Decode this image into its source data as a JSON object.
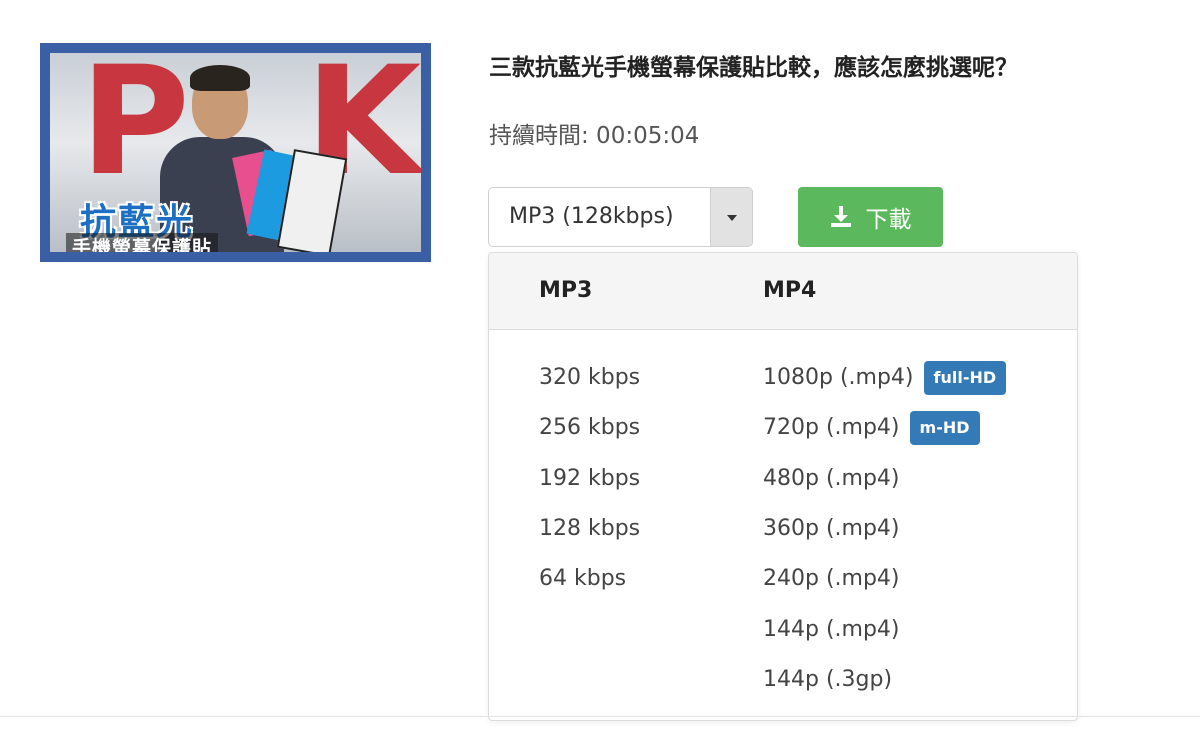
{
  "video": {
    "title": "三款抗藍光手機螢幕保護貼比較，應該怎麼挑選呢？",
    "duration_text": "持續時間: 00:05:04",
    "thumbnail": {
      "big_letters": [
        "P",
        "K"
      ],
      "title_text": "抗藍光",
      "subtitle_text": "手機螢幕保護貼"
    }
  },
  "format_select": {
    "value": "MP3 (128kbps)"
  },
  "download_button": {
    "label": "下載",
    "icon": "download-icon",
    "color": "#5cb85c"
  },
  "dropdown": {
    "columns": [
      {
        "header": "MP3",
        "options": [
          {
            "label": "320 kbps"
          },
          {
            "label": "256 kbps"
          },
          {
            "label": "192 kbps"
          },
          {
            "label": "128 kbps"
          },
          {
            "label": "64 kbps"
          }
        ]
      },
      {
        "header": "MP4",
        "options": [
          {
            "label": "1080p (.mp4)",
            "badge": "full-HD"
          },
          {
            "label": "720p (.mp4)",
            "badge": "m-HD"
          },
          {
            "label": "480p (.mp4)"
          },
          {
            "label": "360p (.mp4)"
          },
          {
            "label": "240p (.mp4)"
          },
          {
            "label": "144p (.mp4)"
          },
          {
            "label": "144p (.3gp)"
          }
        ]
      }
    ],
    "badge_color": "#337ab7"
  }
}
